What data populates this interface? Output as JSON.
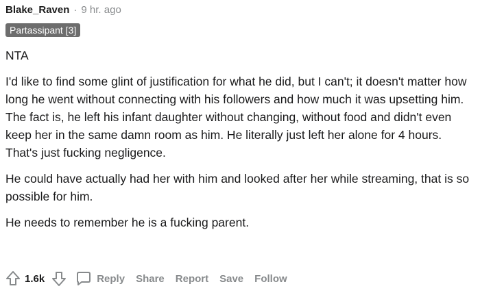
{
  "comment": {
    "username": "Blake_Raven",
    "separator": "·",
    "timestamp": "9 hr. ago",
    "flair": "Partassipant [3]",
    "paragraphs": [
      "NTA",
      "I'd like to find some glint of justification for what he did, but I can't; it doesn't matter how long he went without connecting with his followers and how much it was upsetting him. The fact is, he left his infant daughter without changing, without food and didn't even keep her in the same damn room as him. He literally just left her alone for 4 hours. That's just fucking negligence.",
      "He could have actually had her with him and looked after her while streaming, that is so possible for him.",
      "He needs to remember he is a fucking parent."
    ]
  },
  "actions": {
    "upvote_icon": "arrow-up-icon",
    "downvote_icon": "arrow-down-icon",
    "reply_icon": "chat-bubble-icon",
    "score": "1.6k",
    "reply": "Reply",
    "share": "Share",
    "report": "Report",
    "save": "Save",
    "follow": "Follow"
  },
  "colors": {
    "flair_bg": "#6d6d6d",
    "muted": "#878a8c",
    "text": "#1a1a1b"
  }
}
